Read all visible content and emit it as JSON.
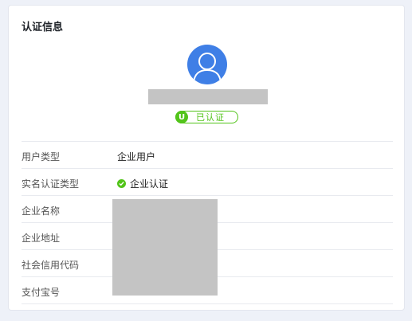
{
  "section": {
    "title": "认证信息"
  },
  "profile": {
    "avatar_icon": "user-avatar-icon",
    "status_badge": {
      "icon_letter": "U",
      "label": "已认证"
    }
  },
  "fields": [
    {
      "label": "用户类型",
      "value": "企业用户"
    },
    {
      "label": "实名认证类型",
      "value": "企业认证",
      "value_icon": "check-circle-icon"
    },
    {
      "label": "企业名称"
    },
    {
      "label": "企业地址"
    },
    {
      "label": "社会信用代码"
    },
    {
      "label": "支付宝号"
    }
  ],
  "colors": {
    "accent_blue": "#3f7fe6",
    "verified_green": "#52c41a",
    "redaction_gray": "#c4c4c4"
  }
}
